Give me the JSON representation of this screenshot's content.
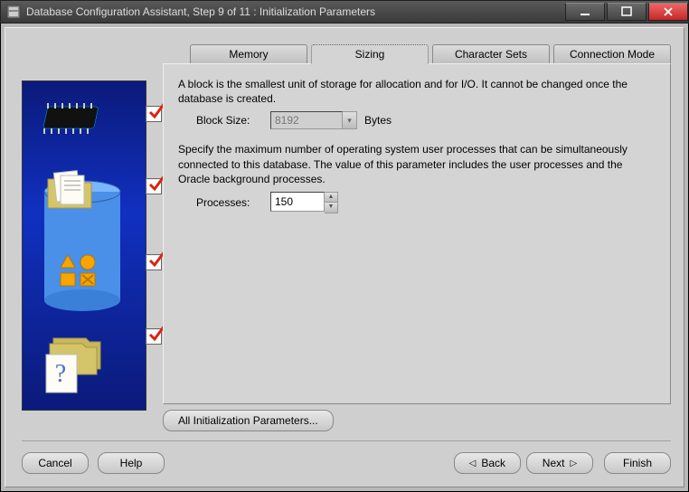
{
  "window": {
    "title": "Database Configuration Assistant, Step 9 of 11 : Initialization Parameters"
  },
  "tabs": {
    "memory": "Memory",
    "sizing": "Sizing",
    "charsets": "Character Sets",
    "connmode": "Connection Mode",
    "active": "sizing"
  },
  "panel": {
    "block_desc": "A block is the smallest unit of storage for allocation and for I/O. It cannot be changed once the database is created.",
    "block_size_label": "Block Size:",
    "block_size_value": "8192",
    "block_size_unit": "Bytes",
    "proc_desc": "Specify the maximum number of operating system user processes that can be simultaneously connected to this database. The value of this parameter includes the user processes and the Oracle background processes.",
    "processes_label": "Processes:",
    "processes_value": "150"
  },
  "buttons": {
    "all_params": "All Initialization Parameters...",
    "cancel": "Cancel",
    "help": "Help",
    "back": "Back",
    "next": "Next",
    "finish": "Finish"
  },
  "sidebar": {
    "steps_checked": [
      true,
      true,
      true,
      true
    ]
  }
}
